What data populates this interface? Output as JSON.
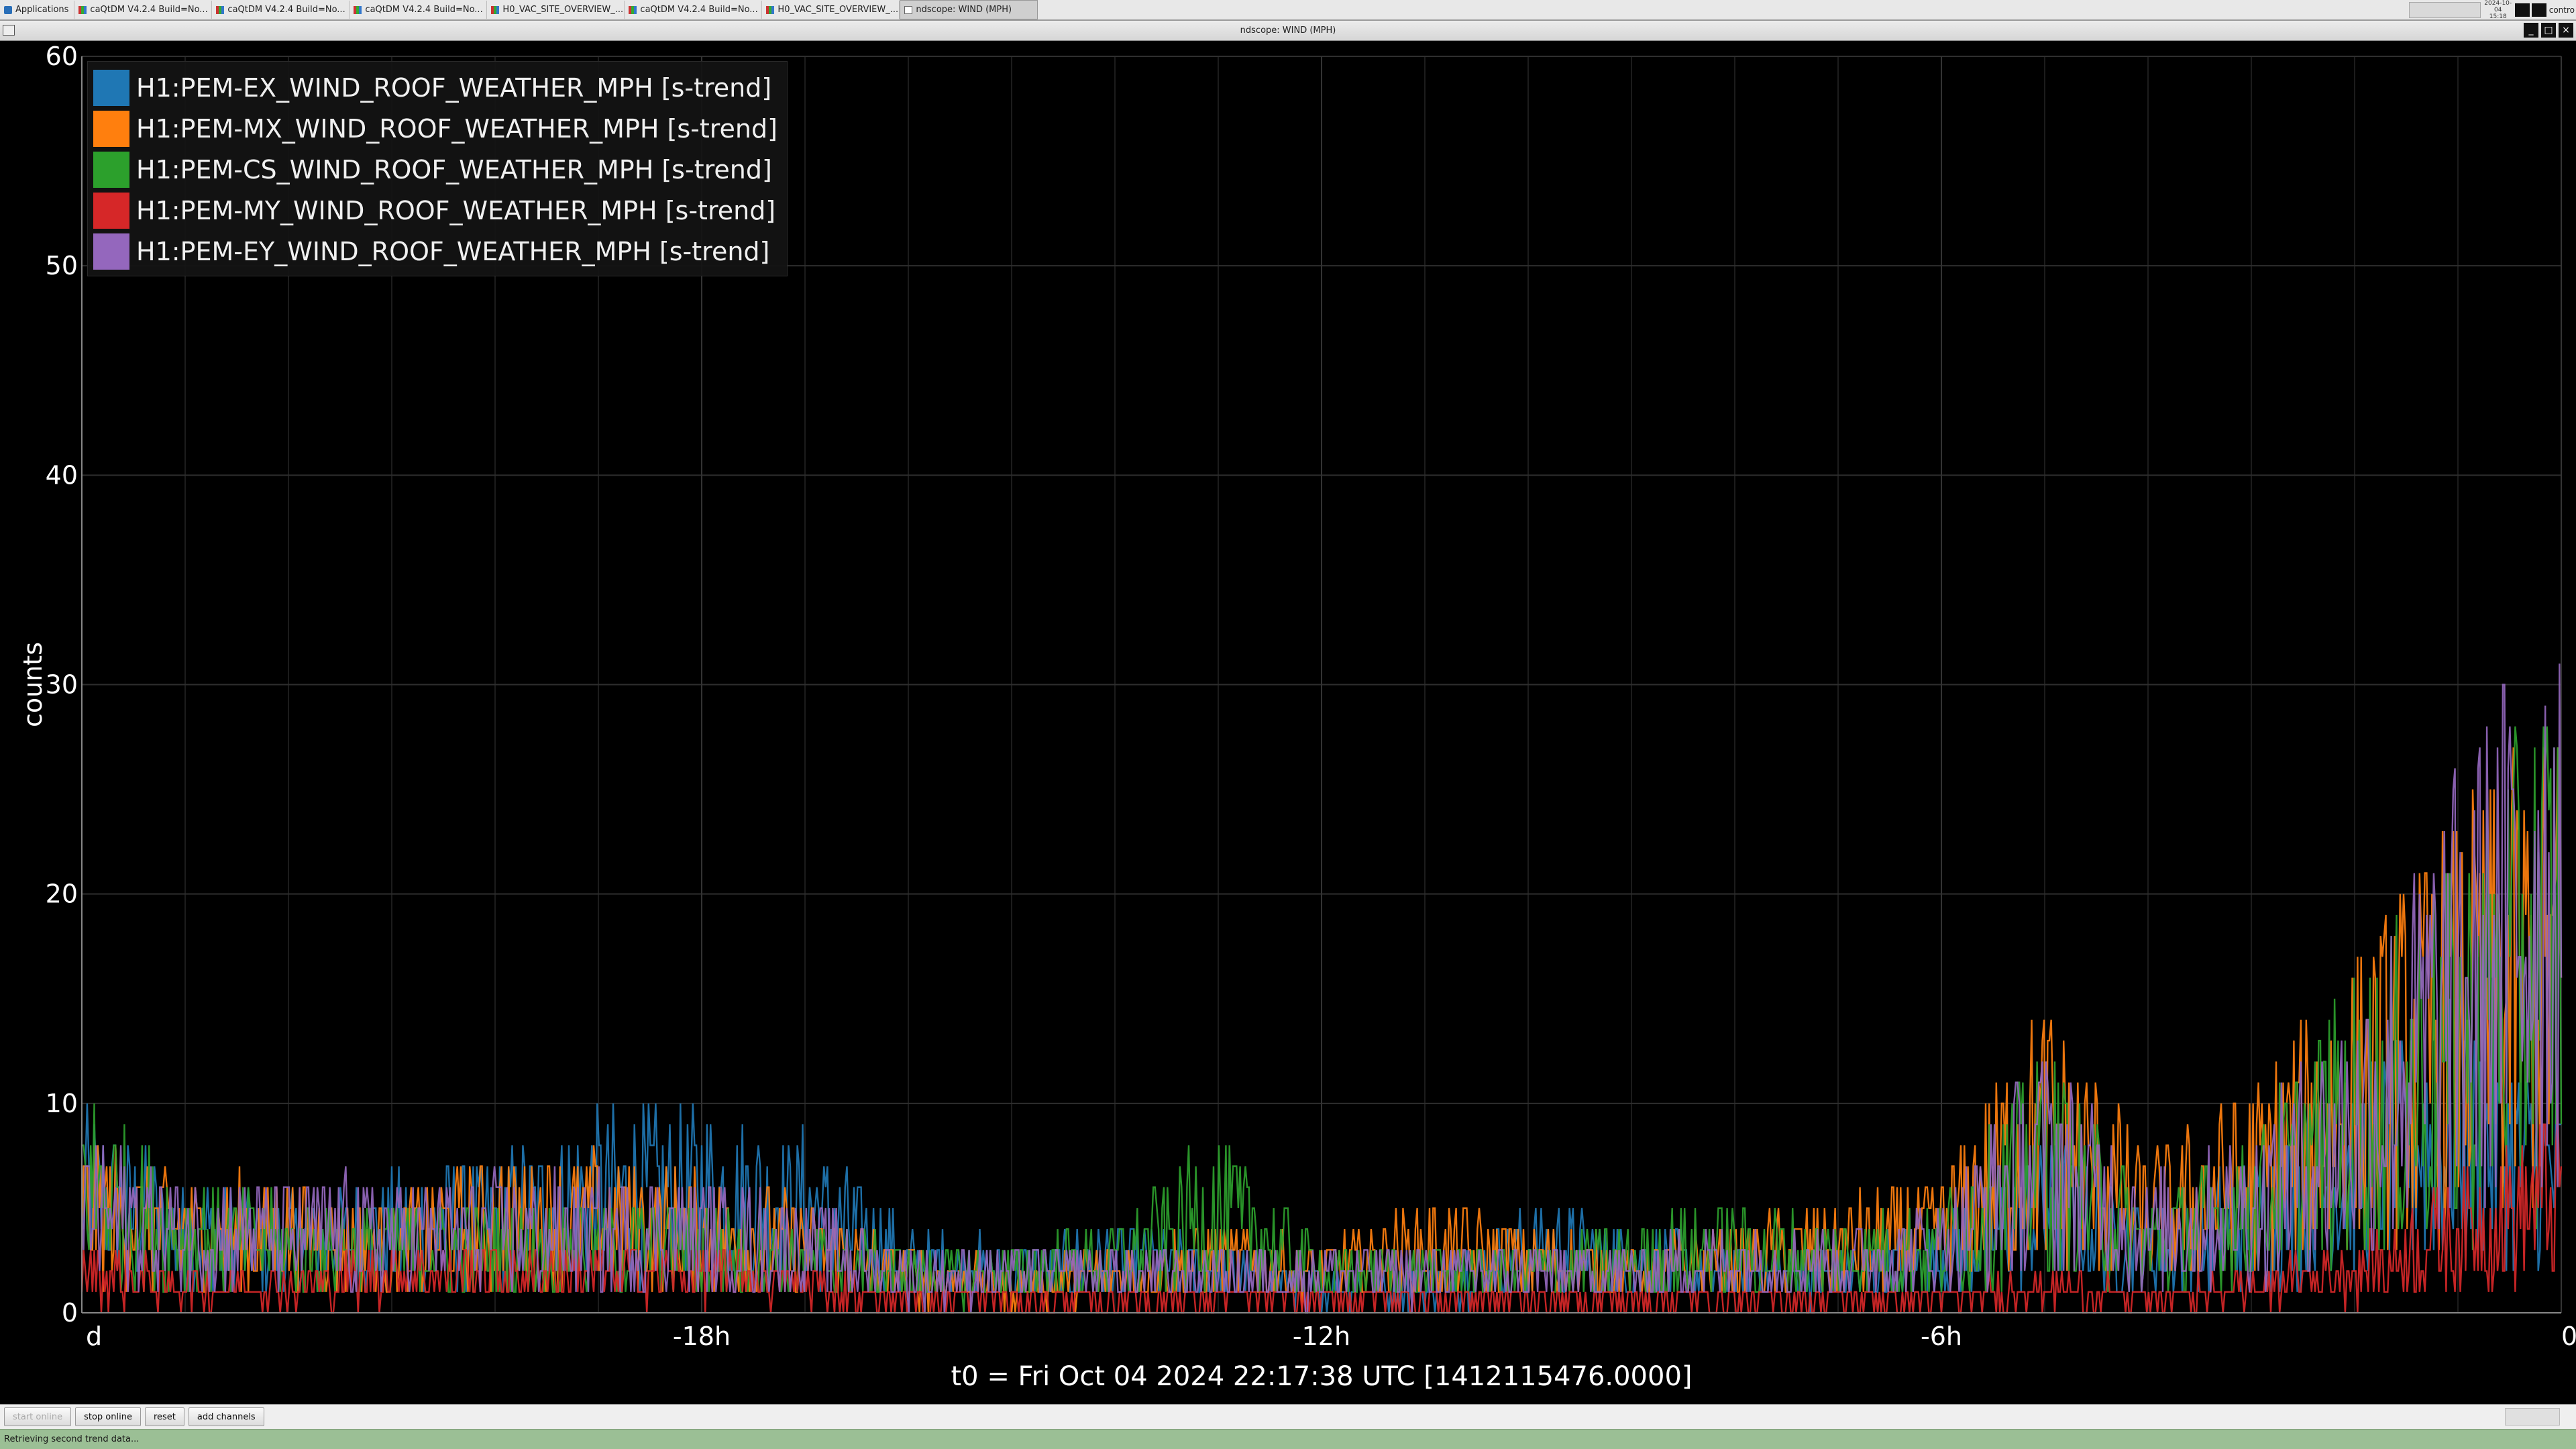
{
  "taskbar": {
    "items": [
      {
        "label": "Applications",
        "icon": "applications-icon"
      },
      {
        "label": "caQtDM V4.2.4 Build=No...",
        "icon": "app-window-icon"
      },
      {
        "label": "caQtDM V4.2.4 Build=No...",
        "icon": "app-window-icon"
      },
      {
        "label": "caQtDM V4.2.4 Build=No...",
        "icon": "app-window-icon"
      },
      {
        "label": "H0_VAC_SITE_OVERVIEW_...",
        "icon": "app-window-icon"
      },
      {
        "label": "caQtDM V4.2.4 Build=No...",
        "icon": "app-window-icon"
      },
      {
        "label": "H0_VAC_SITE_OVERVIEW_...",
        "icon": "app-window-icon"
      },
      {
        "label": "ndscope: WIND (MPH)",
        "icon": "ndscope-icon"
      }
    ],
    "clock_date": "2024-10-04",
    "clock_time": "15:18",
    "user": "contro"
  },
  "window": {
    "title": "ndscope: WIND (MPH)"
  },
  "plot": {
    "xlabel": "t0 = Fri Oct 04 2024 22:17:38 UTC [1412115476.0000]",
    "ylabel": "counts",
    "legend": [
      {
        "label": "H1:PEM-EX_WIND_ROOF_WEATHER_MPH [s-trend]",
        "color": "#1f77b4"
      },
      {
        "label": "H1:PEM-MX_WIND_ROOF_WEATHER_MPH [s-trend]",
        "color": "#ff7f0e"
      },
      {
        "label": "H1:PEM-CS_WIND_ROOF_WEATHER_MPH [s-trend]",
        "color": "#2ca02c"
      },
      {
        "label": "H1:PEM-MY_WIND_ROOF_WEATHER_MPH [s-trend]",
        "color": "#d62728"
      },
      {
        "label": "H1:PEM-EY_WIND_ROOF_WEATHER_MPH [s-trend]",
        "color": "#9467bd"
      }
    ]
  },
  "chart_data": {
    "type": "line",
    "title": "",
    "xlabel": "t0 = Fri Oct 04 2024 22:17:38 UTC [1412115476.0000]",
    "ylabel": "counts",
    "x_unit": "hours relative to t0",
    "xlim": [
      -24,
      0
    ],
    "ylim": [
      0,
      60
    ],
    "x_ticks": [
      {
        "value": -24,
        "label": "d"
      },
      {
        "value": -18,
        "label": "-18h"
      },
      {
        "value": -12,
        "label": "-12h"
      },
      {
        "value": -6,
        "label": "-6h"
      },
      {
        "value": 0,
        "label": "0"
      }
    ],
    "y_ticks": [
      0,
      10,
      20,
      30,
      40,
      50,
      60
    ],
    "grid": true,
    "legend_position": "top-left",
    "x": [
      -24,
      -23,
      -22,
      -21,
      -20,
      -19,
      -18,
      -17,
      -16,
      -15,
      -14,
      -13,
      -12,
      -11,
      -10,
      -9,
      -8,
      -7,
      -6,
      -5,
      -4,
      -3,
      -2,
      -1,
      0
    ],
    "series": [
      {
        "name": "H1:PEM-EX_WIND_ROOF_WEATHER_MPH [s-trend]",
        "color": "#1f77b4",
        "values": [
          9,
          6,
          5,
          6,
          7,
          9,
          9,
          8,
          4,
          3,
          4,
          3,
          2,
          2,
          5,
          4,
          3,
          3,
          4,
          8,
          5,
          7,
          11,
          14,
          10
        ]
      },
      {
        "name": "H1:PEM-MX_WIND_ROOF_WEATHER_MPH [s-trend]",
        "color": "#ff7f0e",
        "values": [
          8,
          6,
          6,
          5,
          7,
          7,
          6,
          5,
          3,
          2,
          3,
          4,
          3,
          5,
          4,
          3,
          4,
          5,
          6,
          14,
          7,
          10,
          16,
          22,
          26
        ]
      },
      {
        "name": "H1:PEM-CS_WIND_ROOF_WEATHER_MPH [s-trend]",
        "color": "#2ca02c",
        "values": [
          10,
          6,
          5,
          5,
          5,
          5,
          5,
          4,
          3,
          3,
          4,
          8,
          3,
          3,
          3,
          4,
          5,
          4,
          5,
          12,
          5,
          8,
          15,
          20,
          30
        ]
      },
      {
        "name": "H1:PEM-MY_WIND_ROOF_WEATHER_MPH [s-trend]",
        "color": "#d62728",
        "values": [
          3,
          2,
          2,
          3,
          3,
          3,
          3,
          2,
          1,
          1,
          1,
          1,
          1,
          1,
          1,
          1,
          1,
          1,
          1,
          2,
          1,
          2,
          3,
          6,
          9
        ]
      },
      {
        "name": "H1:PEM-EY_WIND_ROOF_WEATHER_MPH [s-trend]",
        "color": "#9467bd",
        "values": [
          8,
          6,
          6,
          6,
          6,
          6,
          6,
          5,
          3,
          3,
          3,
          3,
          3,
          3,
          3,
          3,
          4,
          4,
          5,
          12,
          6,
          8,
          14,
          24,
          34
        ]
      }
    ]
  },
  "toolbar": {
    "start_label": "start online",
    "stop_label": "stop online",
    "reset_label": "reset",
    "add_label": "add channels"
  },
  "status": {
    "message": "Retrieving second trend data..."
  }
}
